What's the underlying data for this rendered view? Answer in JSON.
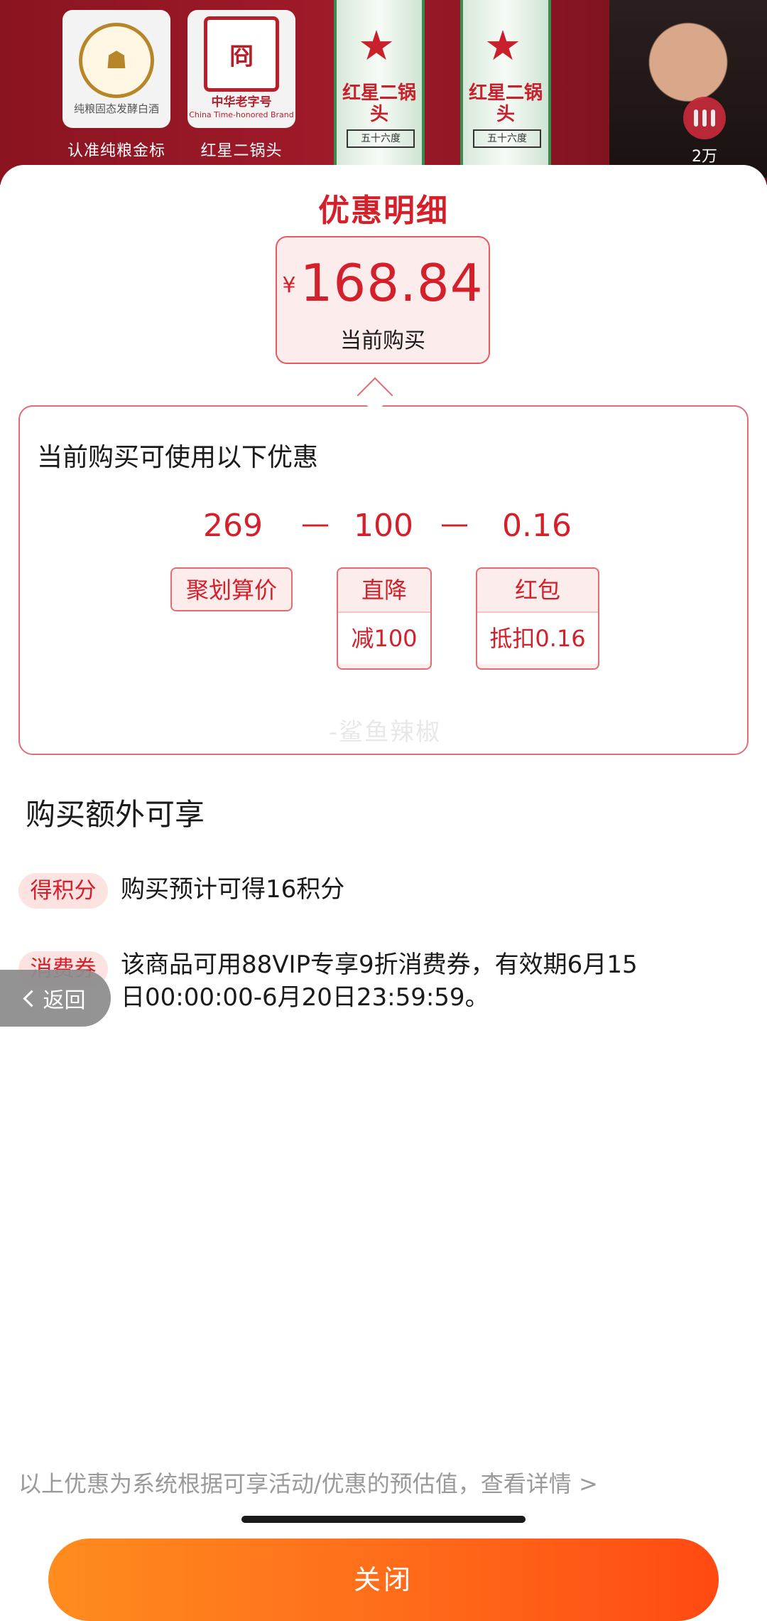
{
  "banner": {
    "badge1_caption": "认准纯粮金标",
    "badge1_text": "纯粮固态发酵白酒",
    "badge2_caption": "红星二锅头",
    "badge2_title": "中华老字号",
    "badge2_sub": "China Time-honored Brand",
    "bottle_label": "红星二锅头",
    "bottle_degree": "五十六度",
    "float_count": "2万"
  },
  "sheet": {
    "title": "优惠明细",
    "price": {
      "currency": "¥",
      "amount": "168.84",
      "caption": "当前购买"
    },
    "card": {
      "title": "当前购买可使用以下优惠",
      "numbers": [
        "269",
        "100",
        "0.16"
      ],
      "operators": [
        "—",
        "—"
      ],
      "tags": [
        {
          "top": "聚划算价",
          "bottom": ""
        },
        {
          "top": "直降",
          "bottom": "减100"
        },
        {
          "top": "红包",
          "bottom": "抵扣0.16"
        }
      ],
      "watermark": "-鲨鱼辣椒"
    },
    "extra_title": "购买额外可享",
    "perks": [
      {
        "tag": "得积分",
        "text": "购买预计可得16积分"
      },
      {
        "tag": "消费券",
        "text": "该商品可用88VIP专享9折消费券，有效期6月15日00:00:00-6月20日23:59:59。"
      }
    ],
    "footnote": "以上优惠为系统根据可享活动/优惠的预估值，查看详情 >",
    "close_label": "关闭"
  },
  "back_button": {
    "label": "返回"
  },
  "colors": {
    "accent_red": "#d4202a",
    "button_orange": "#ff6a1a"
  }
}
